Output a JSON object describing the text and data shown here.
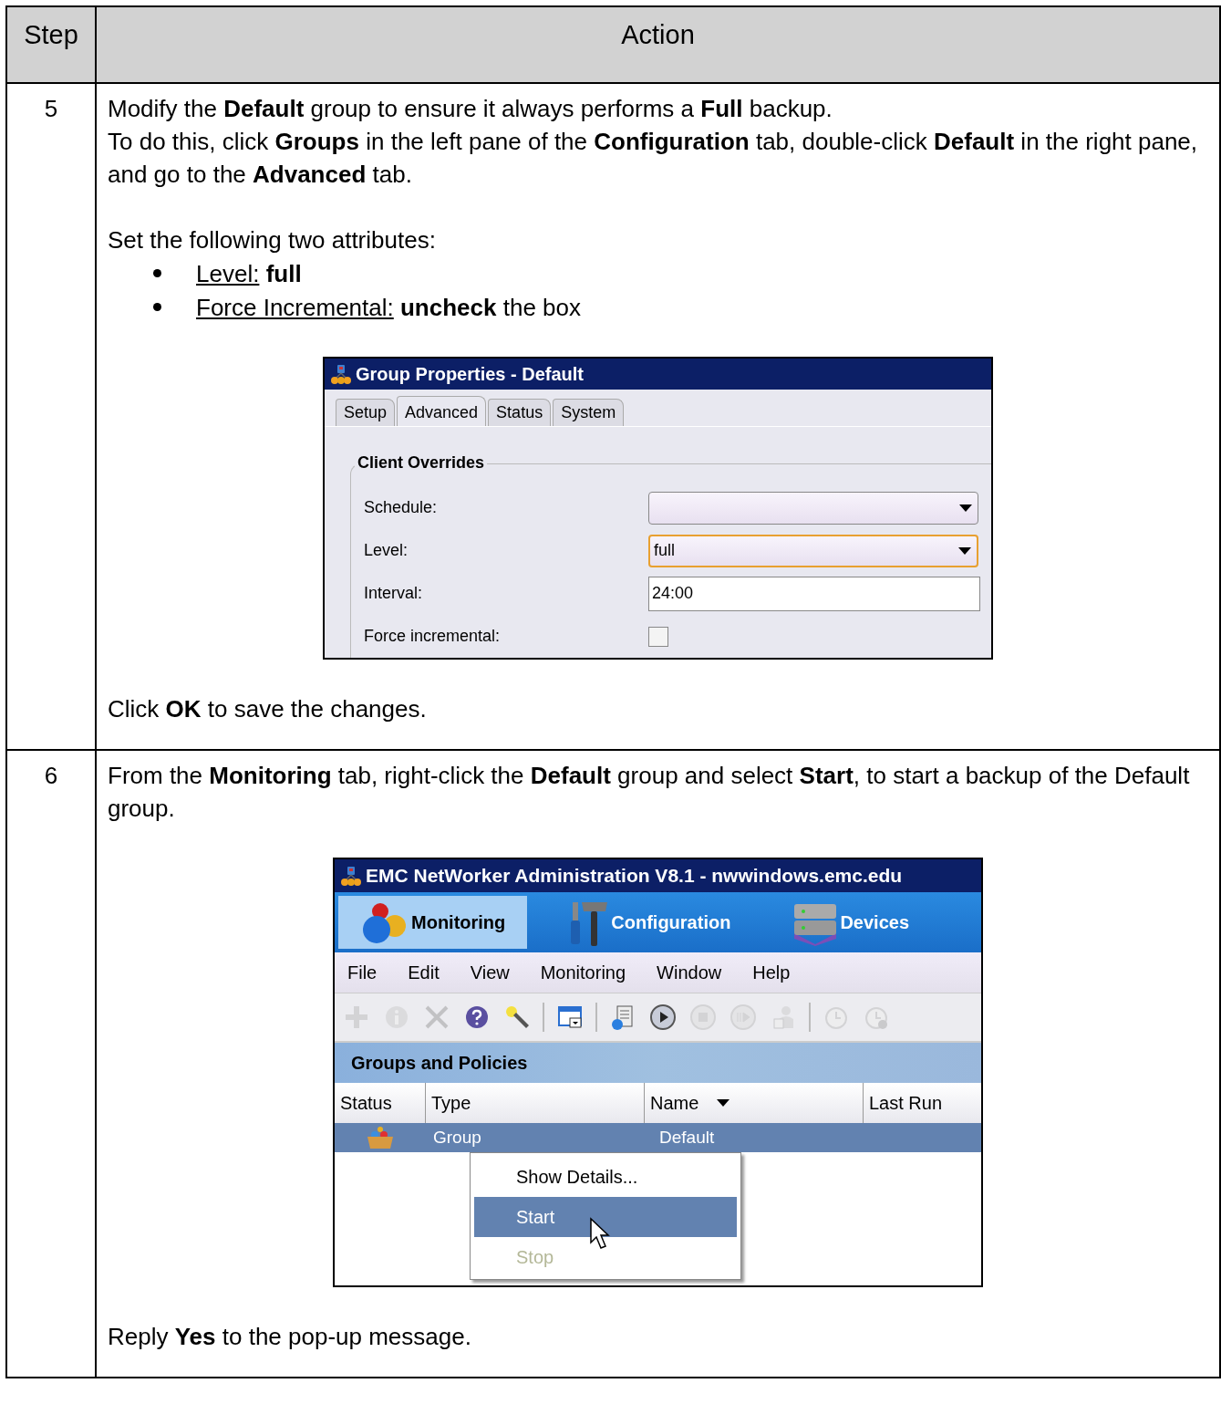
{
  "table": {
    "columns": [
      "Step",
      "Action"
    ],
    "rows": [
      {
        "step": "5",
        "blocks": [
          {
            "kind": "text",
            "lines": [
              "Modify the **Default** group to ensure it always performs a **Full** backup.",
              "To do this, click **Groups** in the left pane of the **Configuration** tab, double-click **Default** in the right pane, and go to the **Advanced** tab."
            ]
          },
          {
            "kind": "text",
            "lines": [
              "Set the following two attributes:"
            ]
          },
          {
            "kind": "bullets",
            "items": [
              {
                "label": "Level:",
                "text": " **full**"
              },
              {
                "label": "Force Incremental:",
                "text": " **uncheck** the box"
              }
            ]
          },
          {
            "kind": "dialog",
            "title": "Group Properties - Default",
            "tabs": [
              {
                "label": "Setup",
                "selected": false
              },
              {
                "label": "Advanced",
                "selected": true
              },
              {
                "label": "Status",
                "selected": false
              },
              {
                "label": "System",
                "selected": false
              }
            ],
            "group": "Client Overrides",
            "fields": [
              {
                "kind": "dropdown",
                "label": "Schedule:",
                "focused": false
              },
              {
                "kind": "dropdown",
                "label": "Level:",
                "value": "full",
                "focused": true
              },
              {
                "kind": "text",
                "label": "Interval:",
                "value": "24:00",
                "focused": false
              },
              {
                "kind": "checkbox",
                "label": "Force incremental:",
                "checked": false
              }
            ]
          },
          {
            "kind": "text",
            "lines": [
              "Click **OK** to save the changes."
            ]
          }
        ]
      },
      {
        "step": "6",
        "blocks": [
          {
            "kind": "text",
            "lines": [
              "From the **Monitoring** tab, right-click the **Default** group and select **Start**, to start a backup of the Default group."
            ]
          },
          {
            "kind": "app",
            "title": "EMC NetWorker Administration V8.1 - nwwindows.emc.edu",
            "nav": [
              {
                "label": "Monitoring",
                "selected": true
              },
              {
                "label": "Configuration",
                "selected": false
              },
              {
                "label": "Devices",
                "selected": false
              }
            ],
            "menu": [
              "File",
              "Edit",
              "View",
              "Monitoring",
              "Window",
              "Help"
            ],
            "toolbar": [
              {
                "disabled": true
              },
              {
                "disabled": true
              },
              {
                "disabled": true
              },
              {
                "disabled": false
              },
              {
                "disabled": false
              },
              {
                "disabled": false
              },
              {
                "disabled": false
              },
              {
                "disabled": false
              },
              {
                "disabled": true
              },
              {
                "disabled": true
              },
              {
                "disabled": true
              },
              {
                "disabled": true
              },
              {
                "disabled": true
              }
            ],
            "panel": "Groups and Policies",
            "columns": [
              "Status",
              "Type",
              "Name",
              "Last Run"
            ],
            "rows": [
              {
                "type": "Group",
                "name": "Default",
                "selected": true
              }
            ],
            "context_menu": [
              {
                "label": "Show Details...",
                "selected": false,
                "disabled": false
              },
              {
                "label": "Start",
                "selected": true,
                "disabled": false
              },
              {
                "label": "Stop",
                "selected": false,
                "disabled": true
              }
            ]
          },
          {
            "kind": "text",
            "lines": [
              "Reply **Yes** to the pop-up message."
            ]
          }
        ]
      }
    ]
  }
}
